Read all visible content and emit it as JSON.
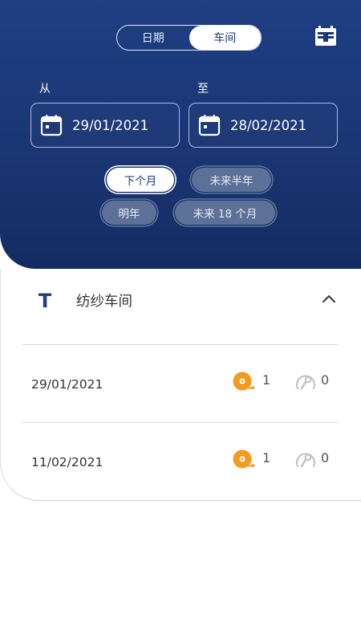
{
  "tabs": {
    "date_label": "日期",
    "workshop_label": "车间"
  },
  "range": {
    "from_label": "从",
    "from_date": "29/01/2021",
    "to_label": "至",
    "to_date": "28/02/2021"
  },
  "quick_filters": {
    "next_month": "下个月",
    "next_half_year": "未来半年",
    "next_year": "明年",
    "next_18_months": "未来 18 个月"
  },
  "workshop": {
    "icon_letter": "T",
    "title": "纺纱车间",
    "rows": [
      {
        "date": "29/01/2021",
        "orange_count": "1",
        "gray_count": "0"
      },
      {
        "date": "11/02/2021",
        "orange_count": "1",
        "gray_count": "0"
      }
    ]
  },
  "colors": {
    "header_blue": "#1a3674",
    "accent_orange": "#f39a1f",
    "muted_gray": "#c4c4c4",
    "text_dark": "#333333"
  },
  "icons": {
    "top_right": "calendar-card-icon",
    "date_field": "calendar-icon",
    "expand": "chevron-up-icon",
    "orange_metric": "orange-reel-icon",
    "gray_metric": "gauge-wrench-icon"
  }
}
